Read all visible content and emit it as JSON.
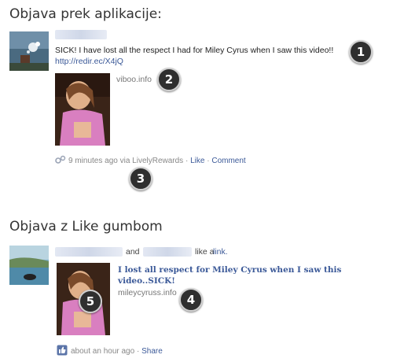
{
  "section1": {
    "title": "Objava prek aplikacije:",
    "post_text": "SICK! I have lost all the respect I had for Miley Cyrus when I saw this video!!",
    "post_link": "http://redir.ec/X4jQ",
    "link_domain": "viboo.info",
    "time": "9 minutes ago via LivelyRewards",
    "sep1": "·",
    "like_label": "Like",
    "sep2": "·",
    "comment_label": "Comment",
    "icon": "app-gear-icon"
  },
  "section2": {
    "title": "Objava z Like gumbom",
    "and_text": "and",
    "like_a_text": "like a",
    "link_text": "link.",
    "headline": "I lost all respect for Miley Cyrus when I saw this video..SICK!",
    "link_domain": "mileycyruss.info",
    "time": "about an hour ago",
    "sep": "·",
    "share_label": "Share",
    "icon": "like-thumb-icon"
  },
  "markers": [
    "1",
    "2",
    "3",
    "4",
    "5"
  ],
  "colors": {
    "link": "#3b5998",
    "marker_bg": "#2f2f2f",
    "text": "#333333",
    "meta": "#888888"
  }
}
